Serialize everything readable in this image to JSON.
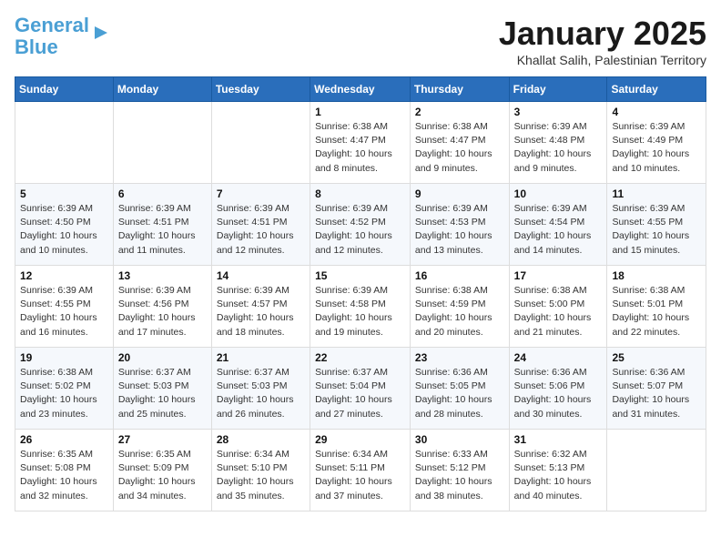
{
  "logo": {
    "line1": "General",
    "line2": "Blue"
  },
  "title": "January 2025",
  "subtitle": "Khallat Salih, Palestinian Territory",
  "weekdays": [
    "Sunday",
    "Monday",
    "Tuesday",
    "Wednesday",
    "Thursday",
    "Friday",
    "Saturday"
  ],
  "weeks": [
    [
      {
        "day": "",
        "detail": ""
      },
      {
        "day": "",
        "detail": ""
      },
      {
        "day": "",
        "detail": ""
      },
      {
        "day": "1",
        "detail": "Sunrise: 6:38 AM\nSunset: 4:47 PM\nDaylight: 10 hours\nand 8 minutes."
      },
      {
        "day": "2",
        "detail": "Sunrise: 6:38 AM\nSunset: 4:47 PM\nDaylight: 10 hours\nand 9 minutes."
      },
      {
        "day": "3",
        "detail": "Sunrise: 6:39 AM\nSunset: 4:48 PM\nDaylight: 10 hours\nand 9 minutes."
      },
      {
        "day": "4",
        "detail": "Sunrise: 6:39 AM\nSunset: 4:49 PM\nDaylight: 10 hours\nand 10 minutes."
      }
    ],
    [
      {
        "day": "5",
        "detail": "Sunrise: 6:39 AM\nSunset: 4:50 PM\nDaylight: 10 hours\nand 10 minutes."
      },
      {
        "day": "6",
        "detail": "Sunrise: 6:39 AM\nSunset: 4:51 PM\nDaylight: 10 hours\nand 11 minutes."
      },
      {
        "day": "7",
        "detail": "Sunrise: 6:39 AM\nSunset: 4:51 PM\nDaylight: 10 hours\nand 12 minutes."
      },
      {
        "day": "8",
        "detail": "Sunrise: 6:39 AM\nSunset: 4:52 PM\nDaylight: 10 hours\nand 12 minutes."
      },
      {
        "day": "9",
        "detail": "Sunrise: 6:39 AM\nSunset: 4:53 PM\nDaylight: 10 hours\nand 13 minutes."
      },
      {
        "day": "10",
        "detail": "Sunrise: 6:39 AM\nSunset: 4:54 PM\nDaylight: 10 hours\nand 14 minutes."
      },
      {
        "day": "11",
        "detail": "Sunrise: 6:39 AM\nSunset: 4:55 PM\nDaylight: 10 hours\nand 15 minutes."
      }
    ],
    [
      {
        "day": "12",
        "detail": "Sunrise: 6:39 AM\nSunset: 4:55 PM\nDaylight: 10 hours\nand 16 minutes."
      },
      {
        "day": "13",
        "detail": "Sunrise: 6:39 AM\nSunset: 4:56 PM\nDaylight: 10 hours\nand 17 minutes."
      },
      {
        "day": "14",
        "detail": "Sunrise: 6:39 AM\nSunset: 4:57 PM\nDaylight: 10 hours\nand 18 minutes."
      },
      {
        "day": "15",
        "detail": "Sunrise: 6:39 AM\nSunset: 4:58 PM\nDaylight: 10 hours\nand 19 minutes."
      },
      {
        "day": "16",
        "detail": "Sunrise: 6:38 AM\nSunset: 4:59 PM\nDaylight: 10 hours\nand 20 minutes."
      },
      {
        "day": "17",
        "detail": "Sunrise: 6:38 AM\nSunset: 5:00 PM\nDaylight: 10 hours\nand 21 minutes."
      },
      {
        "day": "18",
        "detail": "Sunrise: 6:38 AM\nSunset: 5:01 PM\nDaylight: 10 hours\nand 22 minutes."
      }
    ],
    [
      {
        "day": "19",
        "detail": "Sunrise: 6:38 AM\nSunset: 5:02 PM\nDaylight: 10 hours\nand 23 minutes."
      },
      {
        "day": "20",
        "detail": "Sunrise: 6:37 AM\nSunset: 5:03 PM\nDaylight: 10 hours\nand 25 minutes."
      },
      {
        "day": "21",
        "detail": "Sunrise: 6:37 AM\nSunset: 5:03 PM\nDaylight: 10 hours\nand 26 minutes."
      },
      {
        "day": "22",
        "detail": "Sunrise: 6:37 AM\nSunset: 5:04 PM\nDaylight: 10 hours\nand 27 minutes."
      },
      {
        "day": "23",
        "detail": "Sunrise: 6:36 AM\nSunset: 5:05 PM\nDaylight: 10 hours\nand 28 minutes."
      },
      {
        "day": "24",
        "detail": "Sunrise: 6:36 AM\nSunset: 5:06 PM\nDaylight: 10 hours\nand 30 minutes."
      },
      {
        "day": "25",
        "detail": "Sunrise: 6:36 AM\nSunset: 5:07 PM\nDaylight: 10 hours\nand 31 minutes."
      }
    ],
    [
      {
        "day": "26",
        "detail": "Sunrise: 6:35 AM\nSunset: 5:08 PM\nDaylight: 10 hours\nand 32 minutes."
      },
      {
        "day": "27",
        "detail": "Sunrise: 6:35 AM\nSunset: 5:09 PM\nDaylight: 10 hours\nand 34 minutes."
      },
      {
        "day": "28",
        "detail": "Sunrise: 6:34 AM\nSunset: 5:10 PM\nDaylight: 10 hours\nand 35 minutes."
      },
      {
        "day": "29",
        "detail": "Sunrise: 6:34 AM\nSunset: 5:11 PM\nDaylight: 10 hours\nand 37 minutes."
      },
      {
        "day": "30",
        "detail": "Sunrise: 6:33 AM\nSunset: 5:12 PM\nDaylight: 10 hours\nand 38 minutes."
      },
      {
        "day": "31",
        "detail": "Sunrise: 6:32 AM\nSunset: 5:13 PM\nDaylight: 10 hours\nand 40 minutes."
      },
      {
        "day": "",
        "detail": ""
      }
    ]
  ]
}
